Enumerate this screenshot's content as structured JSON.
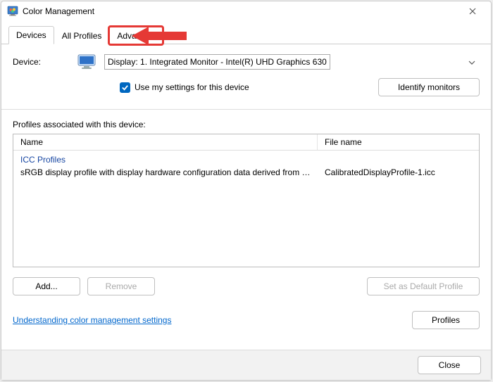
{
  "window": {
    "title": "Color Management"
  },
  "tabs": {
    "devices": "Devices",
    "all_profiles": "All Profiles",
    "advanced": "Advanced"
  },
  "device": {
    "label": "Device:",
    "selected": "Display: 1. Integrated Monitor - Intel(R) UHD Graphics 630",
    "use_my_settings": "Use my settings for this device",
    "identify_btn": "Identify monitors"
  },
  "profiles": {
    "section_label": "Profiles associated with this device:",
    "columns": {
      "name": "Name",
      "file": "File name"
    },
    "group_label": "ICC Profiles",
    "rows": [
      {
        "name": "sRGB display profile with display hardware configuration data derived from cali...",
        "file": "CalibratedDisplayProfile-1.icc"
      }
    ]
  },
  "buttons": {
    "add": "Add...",
    "remove": "Remove",
    "set_default": "Set as Default Profile",
    "profiles": "Profiles",
    "close": "Close"
  },
  "link": {
    "understanding": "Understanding color management settings"
  }
}
